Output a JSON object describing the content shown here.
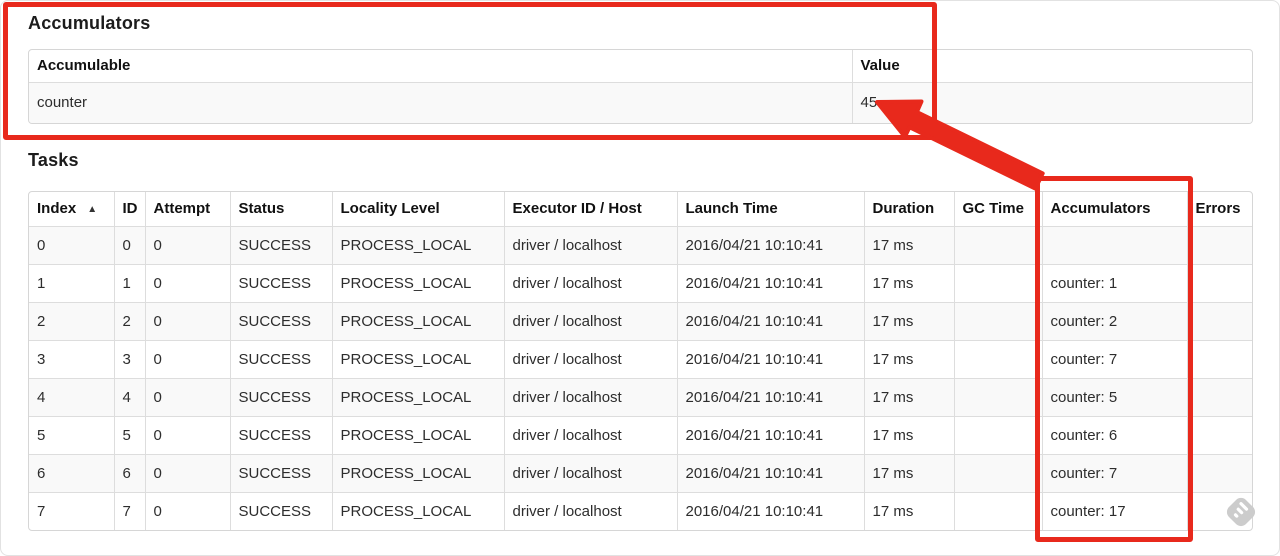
{
  "annotations": {
    "color": "#e8291c",
    "sort_icon": "▲"
  },
  "accumulators_section": {
    "title": "Accumulators",
    "table": {
      "headers": [
        "Accumulable",
        "Value"
      ],
      "rows": [
        [
          "counter",
          "45"
        ]
      ]
    }
  },
  "tasks_section": {
    "title": "Tasks",
    "table": {
      "headers": [
        "Index",
        "ID",
        "Attempt",
        "Status",
        "Locality Level",
        "Executor ID / Host",
        "Launch Time",
        "Duration",
        "GC Time",
        "Accumulators",
        "Errors"
      ],
      "sorted_by": "Index",
      "rows": [
        [
          "0",
          "0",
          "0",
          "SUCCESS",
          "PROCESS_LOCAL",
          "driver / localhost",
          "2016/04/21 10:10:41",
          "17 ms",
          "",
          "",
          ""
        ],
        [
          "1",
          "1",
          "0",
          "SUCCESS",
          "PROCESS_LOCAL",
          "driver / localhost",
          "2016/04/21 10:10:41",
          "17 ms",
          "",
          "counter: 1",
          ""
        ],
        [
          "2",
          "2",
          "0",
          "SUCCESS",
          "PROCESS_LOCAL",
          "driver / localhost",
          "2016/04/21 10:10:41",
          "17 ms",
          "",
          "counter: 2",
          ""
        ],
        [
          "3",
          "3",
          "0",
          "SUCCESS",
          "PROCESS_LOCAL",
          "driver / localhost",
          "2016/04/21 10:10:41",
          "17 ms",
          "",
          "counter: 7",
          ""
        ],
        [
          "4",
          "4",
          "0",
          "SUCCESS",
          "PROCESS_LOCAL",
          "driver / localhost",
          "2016/04/21 10:10:41",
          "17 ms",
          "",
          "counter: 5",
          ""
        ],
        [
          "5",
          "5",
          "0",
          "SUCCESS",
          "PROCESS_LOCAL",
          "driver / localhost",
          "2016/04/21 10:10:41",
          "17 ms",
          "",
          "counter: 6",
          ""
        ],
        [
          "6",
          "6",
          "0",
          "SUCCESS",
          "PROCESS_LOCAL",
          "driver / localhost",
          "2016/04/21 10:10:41",
          "17 ms",
          "",
          "counter: 7",
          ""
        ],
        [
          "7",
          "7",
          "0",
          "SUCCESS",
          "PROCESS_LOCAL",
          "driver / localhost",
          "2016/04/21 10:10:41",
          "17 ms",
          "",
          "counter: 17",
          ""
        ]
      ]
    }
  }
}
